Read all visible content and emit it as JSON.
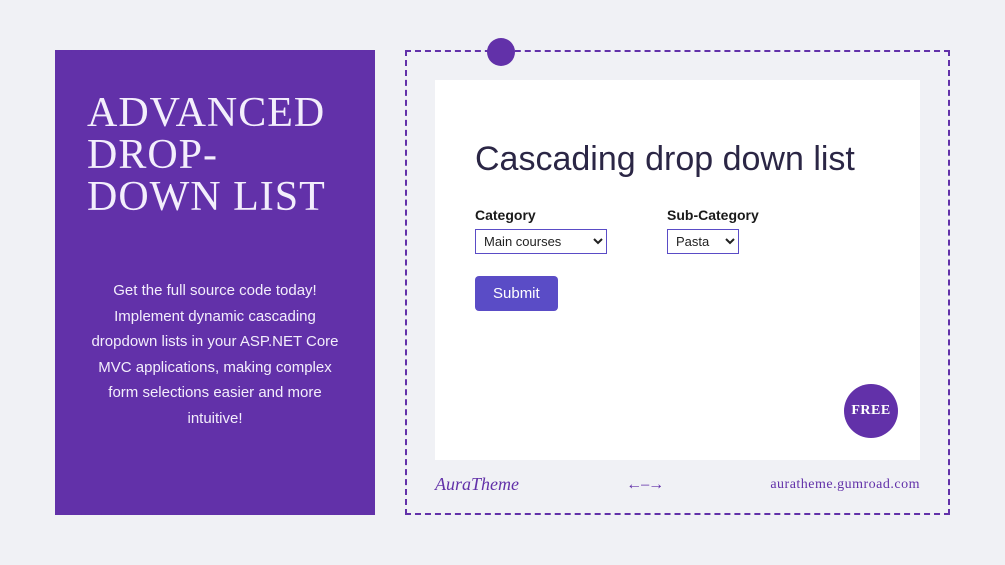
{
  "left": {
    "title": "ADVANCED DROP-DOWN LIST",
    "description": "Get the full source code today! Implement dynamic cascading dropdown lists in your ASP.NET Core MVC applications, making complex form selections easier and more intuitive!"
  },
  "card": {
    "title": "Cascading drop down list",
    "category_label": "Category",
    "category_value": "Main courses",
    "subcategory_label": "Sub-Category",
    "subcategory_value": "Pasta",
    "submit_label": "Submit",
    "badge": "FREE"
  },
  "footer": {
    "brand": "AuraTheme",
    "arrow": "←–→",
    "url": "auratheme.gumroad.com"
  }
}
